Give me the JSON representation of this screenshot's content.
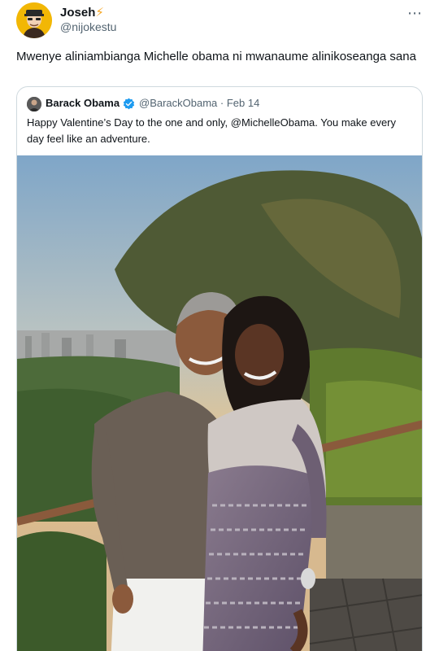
{
  "author": {
    "display_name": "Joseh",
    "badge_emoji": "⚡",
    "handle": "@nijokestu",
    "avatar_icon": "cartoon-avatar-icon"
  },
  "more_icon": "⋯",
  "tweet_text": "Mwenye aliniambianga Michelle obama ni mwanaume alinikoseanga sana",
  "quote": {
    "display_name": "Barack Obama",
    "verified_icon": "verified-badge-icon",
    "handle_date": "@BarackObama · Feb 14",
    "text": "Happy Valentine’s Day to the one and only, @MichelleObama. You make every day feel like an adventure.",
    "photo_icon": "couple-photo"
  },
  "colors": {
    "accent": "#1d9bf0",
    "secondary_text": "#536471",
    "border": "#cfd9de"
  }
}
